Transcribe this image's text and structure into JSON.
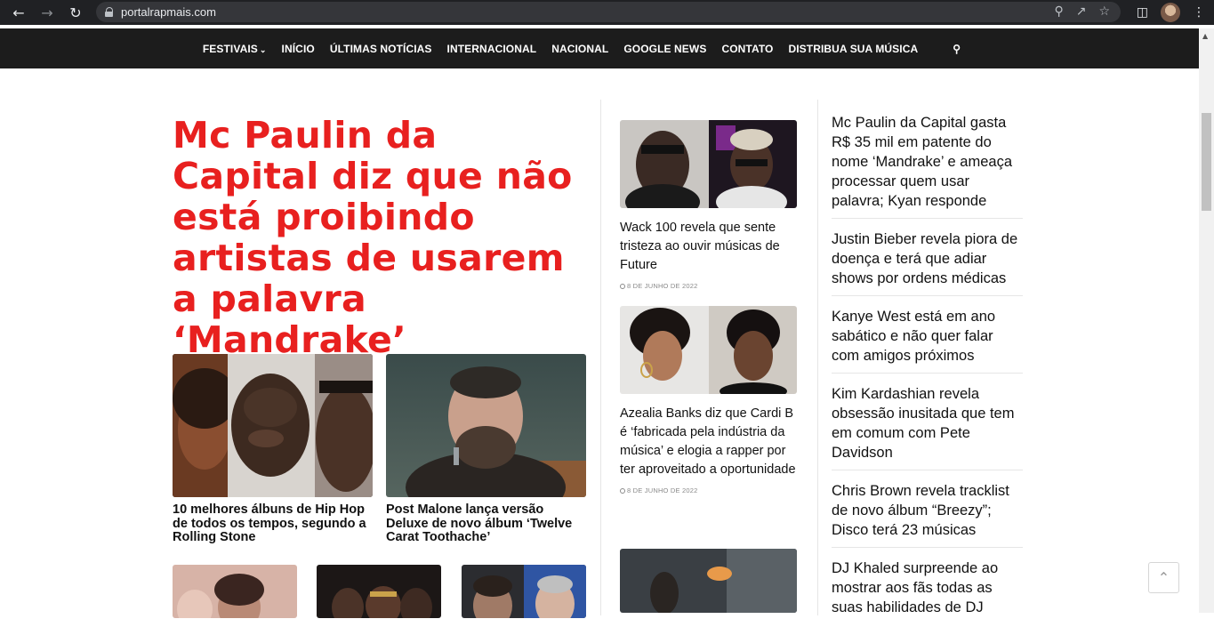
{
  "browser": {
    "url": "portalrapmais.com"
  },
  "nav": {
    "items": [
      "FESTIVAIS",
      "INÍCIO",
      "ÚLTIMAS NOTÍCIAS",
      "INTERNACIONAL",
      "NACIONAL",
      "GOOGLE NEWS",
      "CONTATO",
      "DISTRIBUA SUA MÚSICA"
    ]
  },
  "hero": {
    "title": "Mc Paulin da Capital diz que não está proibindo artistas de usarem a palavra ‘Mandrake’"
  },
  "grid": [
    {
      "title": "10 melhores álbuns de Hip Hop de todos os tempos, segundo a Rolling Stone"
    },
    {
      "title": "Post Malone lança versão Deluxe de novo álbum ‘Twelve Carat Toothache’"
    }
  ],
  "middle": [
    {
      "title": "Wack 100 revela que sente tristeza ao ouvir músicas de Future",
      "date": "8 DE JUNHO DE 2022"
    },
    {
      "title": "Azealia Banks diz que Cardi B é ‘fabricada pela indústria da música’ e elogia a rapper por ter aproveitado a oportunidade",
      "date": "8 DE JUNHO DE 2022"
    }
  ],
  "sidebar": [
    "Mc Paulin da Capital gasta R$ 35 mil em patente do nome ‘Mandrake’ e ameaça processar quem usar palavra; Kyan responde",
    "Justin Bieber revela piora de doença e terá que adiar shows por ordens médicas",
    "Kanye West está em ano sabático e não quer falar com amigos próximos",
    "Kim Kardashian revela obsessão inusitada que tem em comum com Pete Davidson",
    "Chris Brown revela tracklist de novo álbum “Breezy”; Disco terá 23 músicas",
    "DJ Khaled surpreende ao mostrar aos fãs todas as suas habilidades de DJ"
  ],
  "colors": {
    "accent": "#e8201f",
    "nav_bg": "#1c1c1c"
  }
}
